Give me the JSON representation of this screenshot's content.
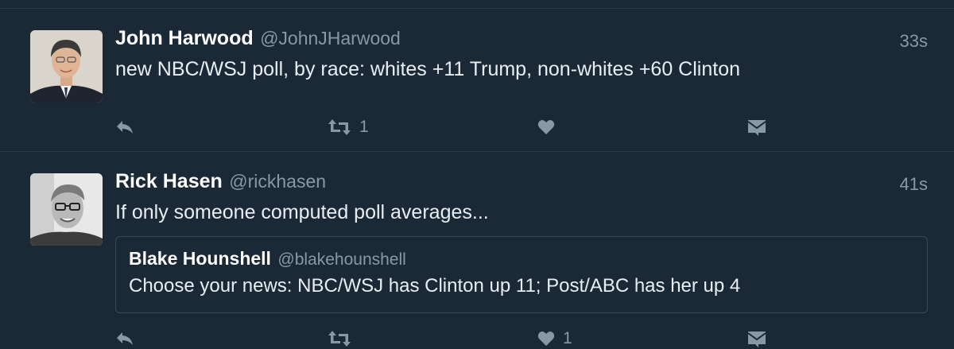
{
  "tweets": [
    {
      "name": "John Harwood",
      "handle": "@JohnJHarwood",
      "time": "33s",
      "text": "new NBC/WSJ poll, by race: whites +11 Trump, non-whites +60 Clinton",
      "retweet_count": "1",
      "like_count": ""
    },
    {
      "name": "Rick Hasen",
      "handle": "@rickhasen",
      "time": "41s",
      "text": "If only someone computed poll averages...",
      "quote": {
        "name": "Blake Hounshell",
        "handle": "@blakehounshell",
        "text": "Choose your news: NBC/WSJ has Clinton up 11; Post/ABC has her up 4"
      },
      "retweet_count": "",
      "like_count": "1"
    }
  ],
  "icons": {
    "reply": "reply-icon",
    "retweet": "retweet-icon",
    "like": "heart-icon",
    "dm": "envelope-icon"
  },
  "colors": {
    "background": "#1b2836",
    "secondary_text": "#8899a6",
    "divider": "#2c3a48"
  }
}
